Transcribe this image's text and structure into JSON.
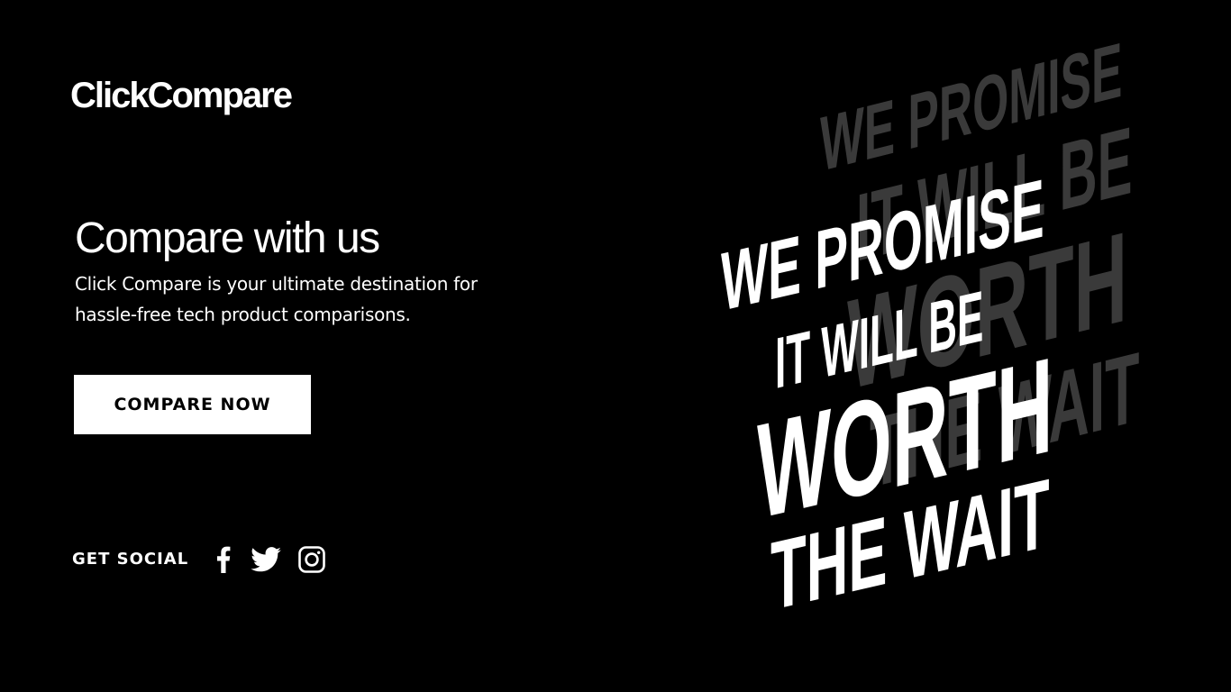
{
  "brand": {
    "name": "ClickCompare"
  },
  "hero": {
    "headline": "Compare with us",
    "description": "Click Compare is your ultimate destination for hassle-free tech product comparisons.",
    "cta_label": "COMPARE NOW"
  },
  "social": {
    "label": "GET SOCIAL",
    "icons": [
      "facebook-icon",
      "twitter-icon",
      "instagram-icon"
    ]
  },
  "artwork": {
    "front_lines": [
      "WE PROMISE",
      "IT WILL BE",
      "WORTH",
      "THE WAIT"
    ],
    "back_lines": [
      "WE PROMISE",
      "IT WILL BE",
      "WORTH",
      "THE WAIT"
    ],
    "front_color": "#ffffff",
    "back_color": "#3a3a3a"
  },
  "colors": {
    "background": "#000000",
    "text": "#ffffff",
    "button_bg": "#ffffff",
    "button_text": "#000000"
  }
}
